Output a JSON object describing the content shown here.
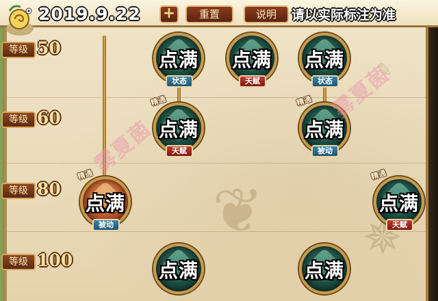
{
  "topbar": {
    "date": "2019.9.22",
    "plus_label": "+",
    "reset_label": "重置",
    "help_label": "说明",
    "note": "请以实际标注为准"
  },
  "levels": [
    {
      "prefix": "等级",
      "value": "50"
    },
    {
      "prefix": "等级",
      "value": "60"
    },
    {
      "prefix": "等级",
      "value": "80"
    },
    {
      "prefix": "等级",
      "value": "100"
    }
  ],
  "skills": {
    "maxed_label": "点满",
    "badge_label": "精通",
    "tag_status": "状态",
    "tag_talent": "天赋",
    "tag_passive": "被动"
  },
  "watermark": "雾夏菌",
  "colors": {
    "parchment": "#efe3c6",
    "button_bg": "#7a341a",
    "button_border": "#e1b770",
    "level_text": "#f8e1a3",
    "tag_blue": "#2f6f92",
    "tag_red": "#a52a1e"
  }
}
